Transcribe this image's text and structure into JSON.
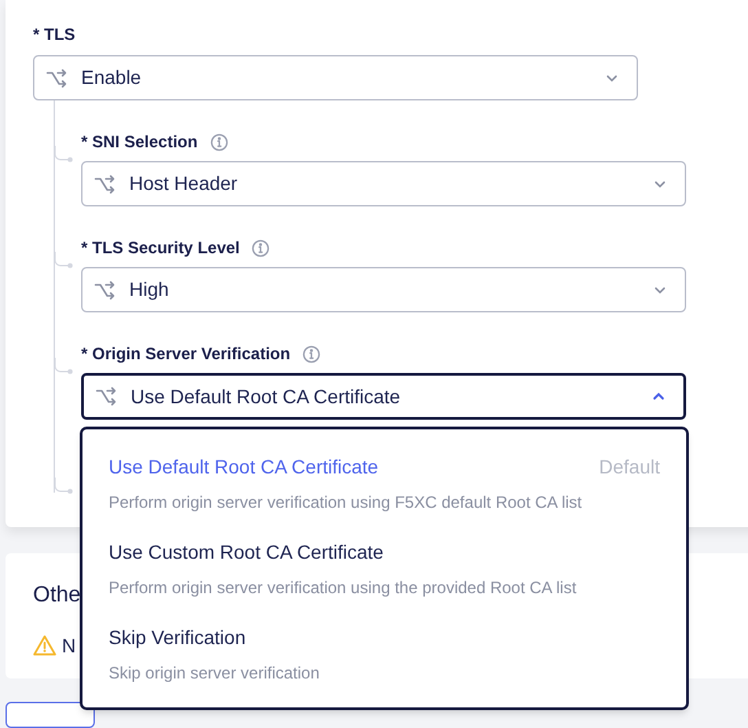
{
  "tls": {
    "label": "* TLS",
    "value": "Enable",
    "expanded": false,
    "fields": [
      {
        "label": "* SNI Selection",
        "info": true,
        "value": "Host Header",
        "expanded": false
      },
      {
        "label": "* TLS Security Level",
        "info": true,
        "value": "High",
        "expanded": false
      },
      {
        "label": "* Origin Server Verification",
        "info": true,
        "value": "Use Default Root CA Certificate",
        "expanded": true
      }
    ]
  },
  "dropdown": {
    "options": [
      {
        "title": "Use Default Root CA Certificate",
        "badge": "Default",
        "description": "Perform origin server verification using F5XC default Root CA list",
        "selected": true
      },
      {
        "title": "Use Custom Root CA Certificate",
        "description": "Perform origin server verification using the provided Root CA list",
        "selected": false
      },
      {
        "title": "Skip Verification",
        "description": "Skip origin server verification",
        "selected": false
      }
    ]
  },
  "other_card": {
    "title": "Othe",
    "warning": "N"
  }
}
